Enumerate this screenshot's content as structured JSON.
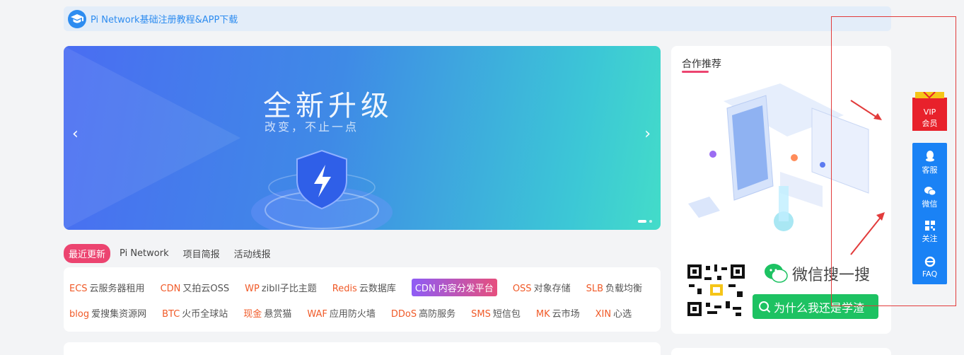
{
  "notice": {
    "text": "Pi Network基础注册教程&APP下载",
    "icon": "graduation-cap-icon"
  },
  "banner": {
    "headline": "全新升级",
    "subline": "改变，不止一点",
    "prev": "‹",
    "next": "›"
  },
  "tabs": [
    {
      "label": "最近更新",
      "active": true
    },
    {
      "label": "Pi Network",
      "active": false
    },
    {
      "label": "项目简报",
      "active": false
    },
    {
      "label": "活动线报",
      "active": false
    }
  ],
  "links_row1": [
    {
      "key": "ECS",
      "label": "云服务器租用"
    },
    {
      "key": "CDN",
      "label": "又拍云OSS"
    },
    {
      "key": "WP",
      "label": "zibll子比主题"
    },
    {
      "key": "Redis",
      "label": "云数据库"
    },
    {
      "key": "",
      "label": "CDN 内容分发平台",
      "highlight": true
    },
    {
      "key": "OSS",
      "label": "对象存储"
    },
    {
      "key": "SLB",
      "label": "负载均衡"
    }
  ],
  "links_row2": [
    {
      "key": "blog",
      "label": "爱搜集资源网"
    },
    {
      "key": "BTC",
      "label": "火币全球站"
    },
    {
      "key": "现金",
      "label": "悬赏猫"
    },
    {
      "key": "WAF",
      "label": "应用防火墙"
    },
    {
      "key": "DDoS",
      "label": "高防服务"
    },
    {
      "key": "SMS",
      "label": "短信包"
    },
    {
      "key": "MK",
      "label": "云市场"
    },
    {
      "key": "XIN",
      "label": "心选"
    }
  ],
  "side": {
    "title": "合作推荐",
    "wechat_text": "微信搜一搜",
    "search_btn": "为什么我还是学渣"
  },
  "float": {
    "vip_line1": "VIP",
    "vip_line2": "会员",
    "items": [
      {
        "label": "客服",
        "icon": "qq-icon"
      },
      {
        "label": "微信",
        "icon": "wechat-icon"
      },
      {
        "label": "关注",
        "icon": "qrcode-icon"
      },
      {
        "label": "FAQ",
        "icon": "ie-icon"
      }
    ]
  },
  "colors": {
    "accent": "#ec4470",
    "blue": "#1a82f5",
    "link_key": "#f05a28",
    "green": "#1dc262"
  }
}
